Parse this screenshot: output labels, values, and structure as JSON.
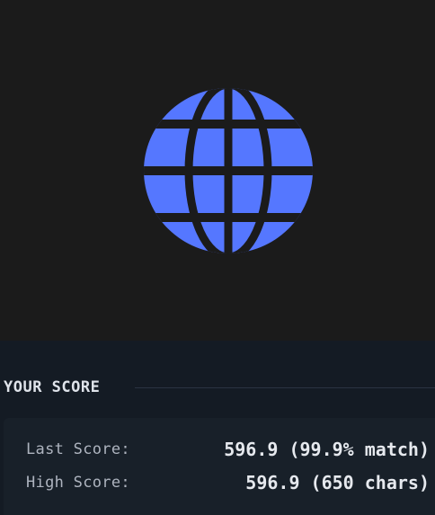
{
  "preview": {
    "icon": "globe-icon",
    "icon_color": "#5577ff",
    "background": "#1b1b1b"
  },
  "score": {
    "heading": "YOUR SCORE",
    "last_label": "Last Score:",
    "last_value": "596.9 (99.9% match)",
    "high_label": "High Score:",
    "high_value": "596.9 (650 chars)"
  }
}
